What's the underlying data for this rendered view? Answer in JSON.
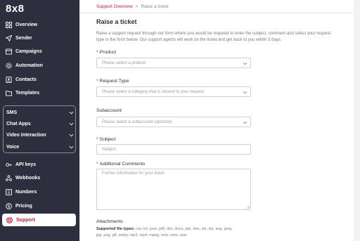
{
  "brand": {
    "logo_text": "8x8",
    "accent": "#c01f3f",
    "sidebar_bg": "#2d2f3e"
  },
  "sidebar": {
    "top_items": [
      {
        "label": "Overview",
        "icon": "grid-icon"
      },
      {
        "label": "Sender",
        "icon": "send-icon"
      },
      {
        "label": "Campaigns",
        "icon": "campaigns-icon"
      },
      {
        "label": "Automation",
        "icon": "automation-icon"
      },
      {
        "label": "Contacts",
        "icon": "contacts-icon"
      },
      {
        "label": "Templates",
        "icon": "folder-icon"
      }
    ],
    "groups": [
      {
        "label": "SMS",
        "icon": "chevron-down-icon"
      },
      {
        "label": "Chat Apps",
        "icon": "chevron-down-icon"
      },
      {
        "label": "Video Interaction",
        "icon": "chevron-down-icon"
      },
      {
        "label": "Voice",
        "icon": "chevron-down-icon"
      }
    ],
    "bottom_items": [
      {
        "label": "API keys",
        "icon": "key-icon"
      },
      {
        "label": "Webhooks",
        "icon": "webhook-icon"
      },
      {
        "label": "Numbers",
        "icon": "numbers-icon"
      },
      {
        "label": "Pricing",
        "icon": "pricing-icon"
      },
      {
        "label": "Support",
        "icon": "support-icon",
        "active": true
      }
    ]
  },
  "breadcrumb": {
    "parent": "Support Overview",
    "separator": ">",
    "current": "Raise a ticket"
  },
  "page": {
    "title": "Raise a ticket",
    "intro": "Raise a support request through our form where you would be required to enter the subject, comment and select your request type in the form below. Our support agents will work on the ticket and get back to you within 3 days."
  },
  "form": {
    "product": {
      "label": "Product",
      "required": "*",
      "placeholder": "Please select a product"
    },
    "request_type": {
      "label": "Request Type",
      "required": "*",
      "placeholder": "Please select a category that is closest to your request"
    },
    "subaccount": {
      "label": "Subaccount",
      "placeholder": "Please select a subaccount (optional)"
    },
    "subject": {
      "label": "Subject",
      "required": "*",
      "placeholder": "Subject"
    },
    "comments": {
      "label": "Additional Comments",
      "required": "*",
      "placeholder": "Further information for your ticket"
    },
    "attachments": {
      "label": "Attachments",
      "types_label": "Supported file types:",
      "types_line1": "csv, txt, json, pdf, doc, docx, ppt, xlsx, xls, zip, avg, jpeg,",
      "types_line2": "jpg, png, gif, webp, mp3, mp4, mpeg, mov, wmv, wav"
    }
  }
}
